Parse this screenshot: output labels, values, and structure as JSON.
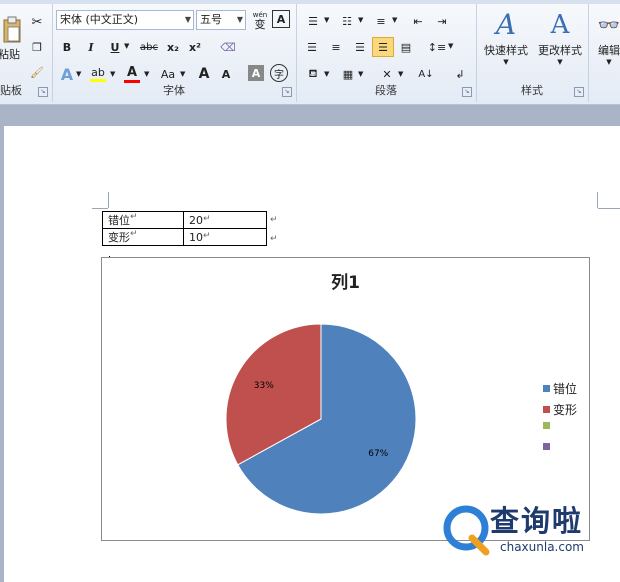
{
  "ribbon": {
    "clipboard": {
      "label": "贴板",
      "paste_label": "粘贴"
    },
    "font": {
      "label": "字体",
      "font_name": "宋体 (中文正文)",
      "font_size": "五号",
      "bold": "B",
      "italic": "I",
      "underline": "U",
      "strike": "abc",
      "subscript": "x₂",
      "superscript": "x²",
      "grow": "A",
      "shrink": "A",
      "case": "Aa",
      "text_effect": "A",
      "highlight": "ab",
      "font_color": "A",
      "char_shade": "A",
      "enclose": "字",
      "phonetic": "wén",
      "phonetic_char": "变",
      "border_char": "A"
    },
    "paragraph": {
      "label": "段落"
    },
    "styles": {
      "label": "样式",
      "quick_styles": "快速样式",
      "change_styles": "更改样式"
    },
    "editing": {
      "label": "编辑"
    }
  },
  "table": {
    "rows": [
      {
        "name": "错位",
        "value": "20"
      },
      {
        "name": "变形",
        "value": "10"
      }
    ]
  },
  "chart_data": {
    "type": "pie",
    "title": "列1",
    "categories": [
      "错位",
      "变形"
    ],
    "values": [
      67,
      33
    ],
    "labels": [
      "67%",
      "33%"
    ],
    "colors": [
      "#4f81bd",
      "#c0504d",
      "#9bbb59",
      "#8064a2"
    ],
    "legend": [
      "错位",
      "变形",
      "",
      ""
    ],
    "legend_position": "right"
  },
  "watermark": {
    "text": "查询啦",
    "url": "chaxunla.com"
  }
}
